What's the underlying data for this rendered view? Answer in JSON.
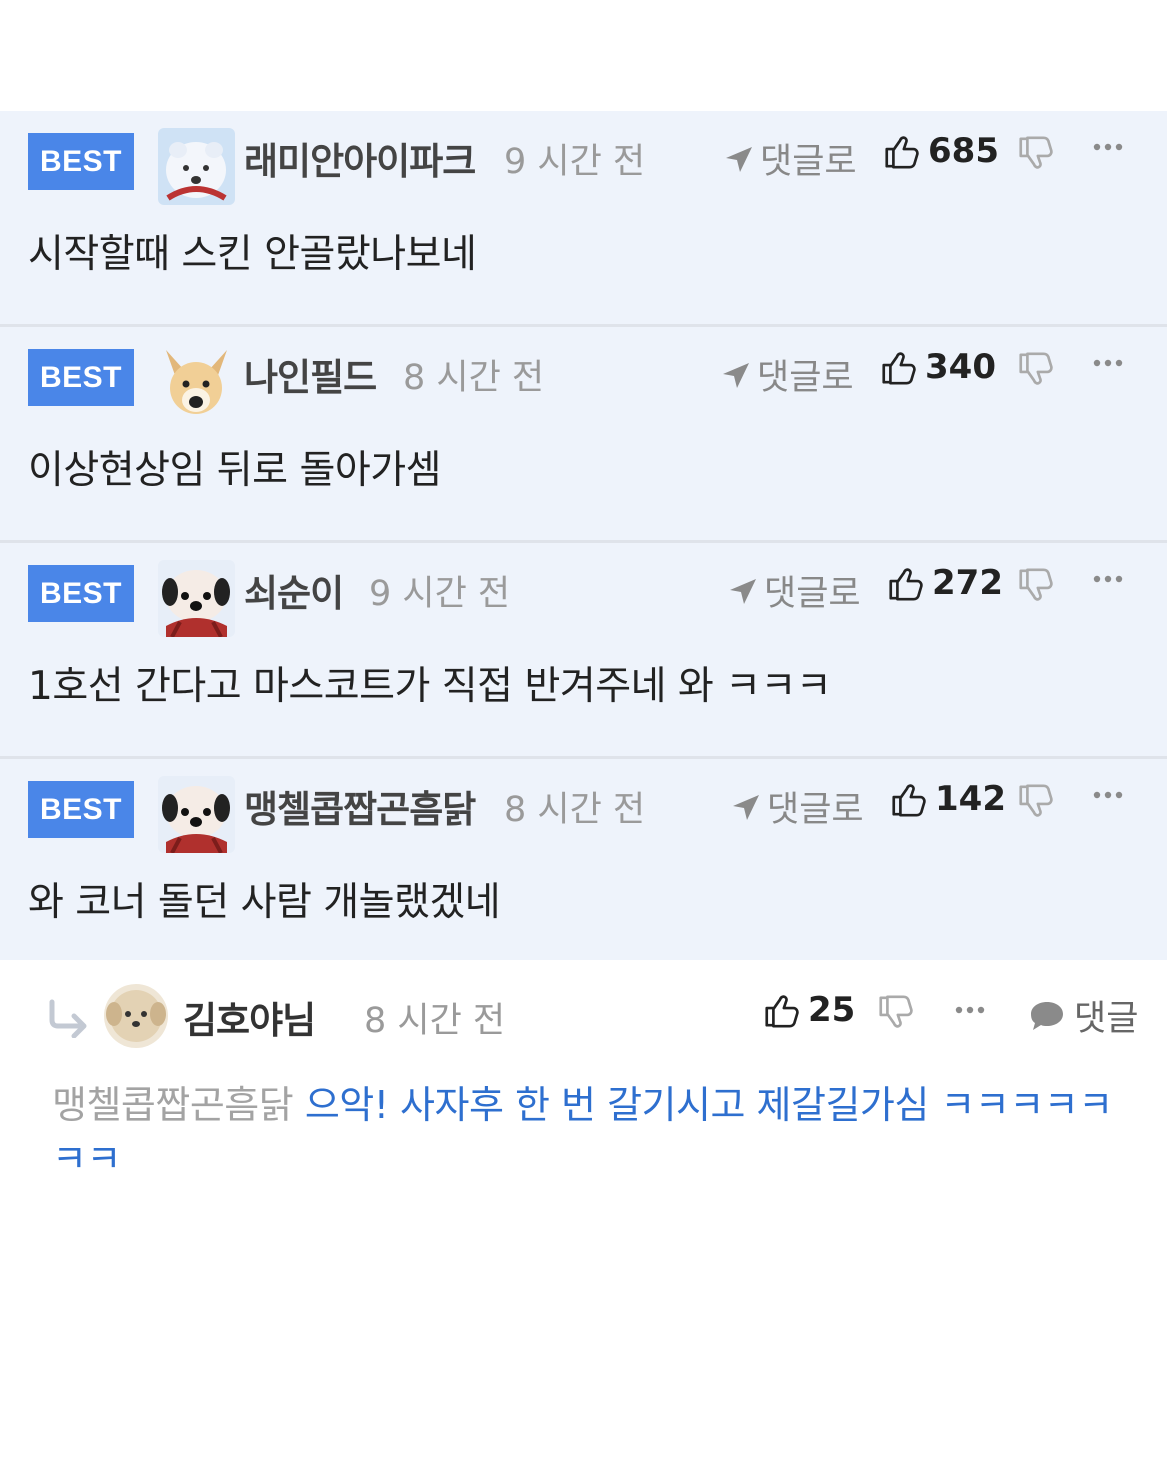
{
  "best_comments": [
    {
      "badge": "BEST",
      "nickname": "래미안아이파크",
      "time": "9 시간 전",
      "reply_label": "댓글로",
      "likes": "685",
      "content": "시작할때 스킨 안골랐나보네",
      "avatar": "polar-bear"
    },
    {
      "badge": "BEST",
      "nickname": "나인필드",
      "time": "8 시간 전",
      "reply_label": "댓글로",
      "likes": "340",
      "content": "이상현상임 뒤로 돌아가셈",
      "avatar": "dog"
    },
    {
      "badge": "BEST",
      "nickname": "쇠순이",
      "time": "9 시간 전",
      "reply_label": "댓글로",
      "likes": "272",
      "content": "1호선 간다고 마스코트가 직접 반겨주네 와 ㅋㅋㅋ",
      "avatar": "dog-scarf"
    },
    {
      "badge": "BEST",
      "nickname": "맹첼콥짭곤흠닭",
      "time": "8 시간 전",
      "reply_label": "댓글로",
      "likes": "142",
      "content": "와 코너 돌던 사람 개놀랬겠네",
      "avatar": "dog-scarf"
    }
  ],
  "reply": {
    "nickname": "김호야님",
    "time": "8 시간 전",
    "likes": "25",
    "comment_label": "댓글",
    "target": "맹첼콥짭곤흠닭",
    "text": "으악! 사자후 한 번 갈기시고 제갈길가심 ㅋㅋㅋㅋㅋㅋㅋ"
  },
  "icons": [
    "reply-arrow-icon",
    "thumbs-up-icon",
    "thumbs-down-icon",
    "more-icon",
    "speech-bubble-icon"
  ],
  "colors": {
    "best_badge": "#4a86e8",
    "best_bg": "#eef3fb",
    "reply_text": "#2e6fcf"
  }
}
